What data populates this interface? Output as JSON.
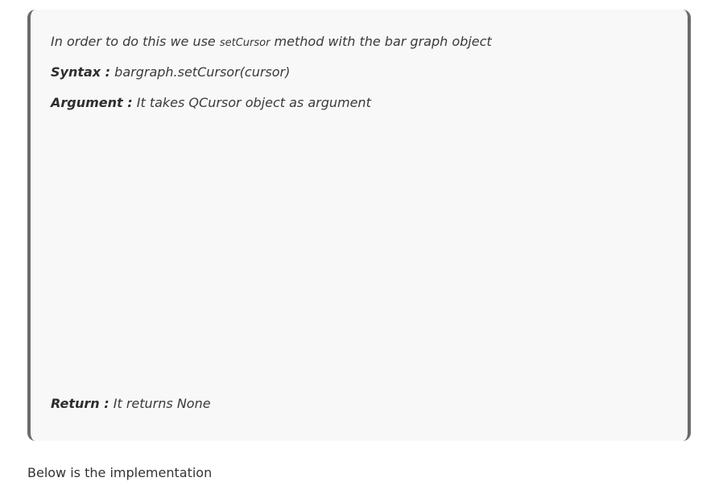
{
  "card": {
    "intro": {
      "before": "In order to do this we use ",
      "code": "setCursor",
      "after": " method with the bar graph object"
    },
    "syntax": {
      "label": "Syntax :",
      "text": " bargraph.setCursor(cursor)"
    },
    "argument": {
      "label": "Argument :",
      "text": " It takes QCursor object as argument"
    },
    "return": {
      "label": "Return :",
      "text": " It returns None"
    }
  },
  "footer_text": "Below is the implementation",
  "colors": {
    "card_background": "#f8f8f8",
    "card_border": "#6b6b6b",
    "text": "#333333"
  }
}
